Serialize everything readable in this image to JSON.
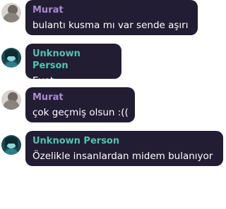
{
  "colors": {
    "bubble_bg": "#221d33",
    "text": "#ffffff"
  },
  "messages": [
    {
      "author": "Murat",
      "name_color": "#a98bd3",
      "avatar": "gray-avatar",
      "text": "bulantı kusma mı var sende aşırı"
    },
    {
      "author": "Unknown Person",
      "name_color": "#4fc4b0",
      "avatar": "teal-avatar",
      "text": "Evet"
    },
    {
      "author": "Murat",
      "name_color": "#a98bd3",
      "avatar": "gray-avatar",
      "text": "çok geçmiş olsun :(("
    },
    {
      "author": "Unknown Person",
      "name_color": "#4fc4b0",
      "avatar": "teal-avatar",
      "text": "Özelikle insanlardan midem bulanıyor"
    }
  ]
}
